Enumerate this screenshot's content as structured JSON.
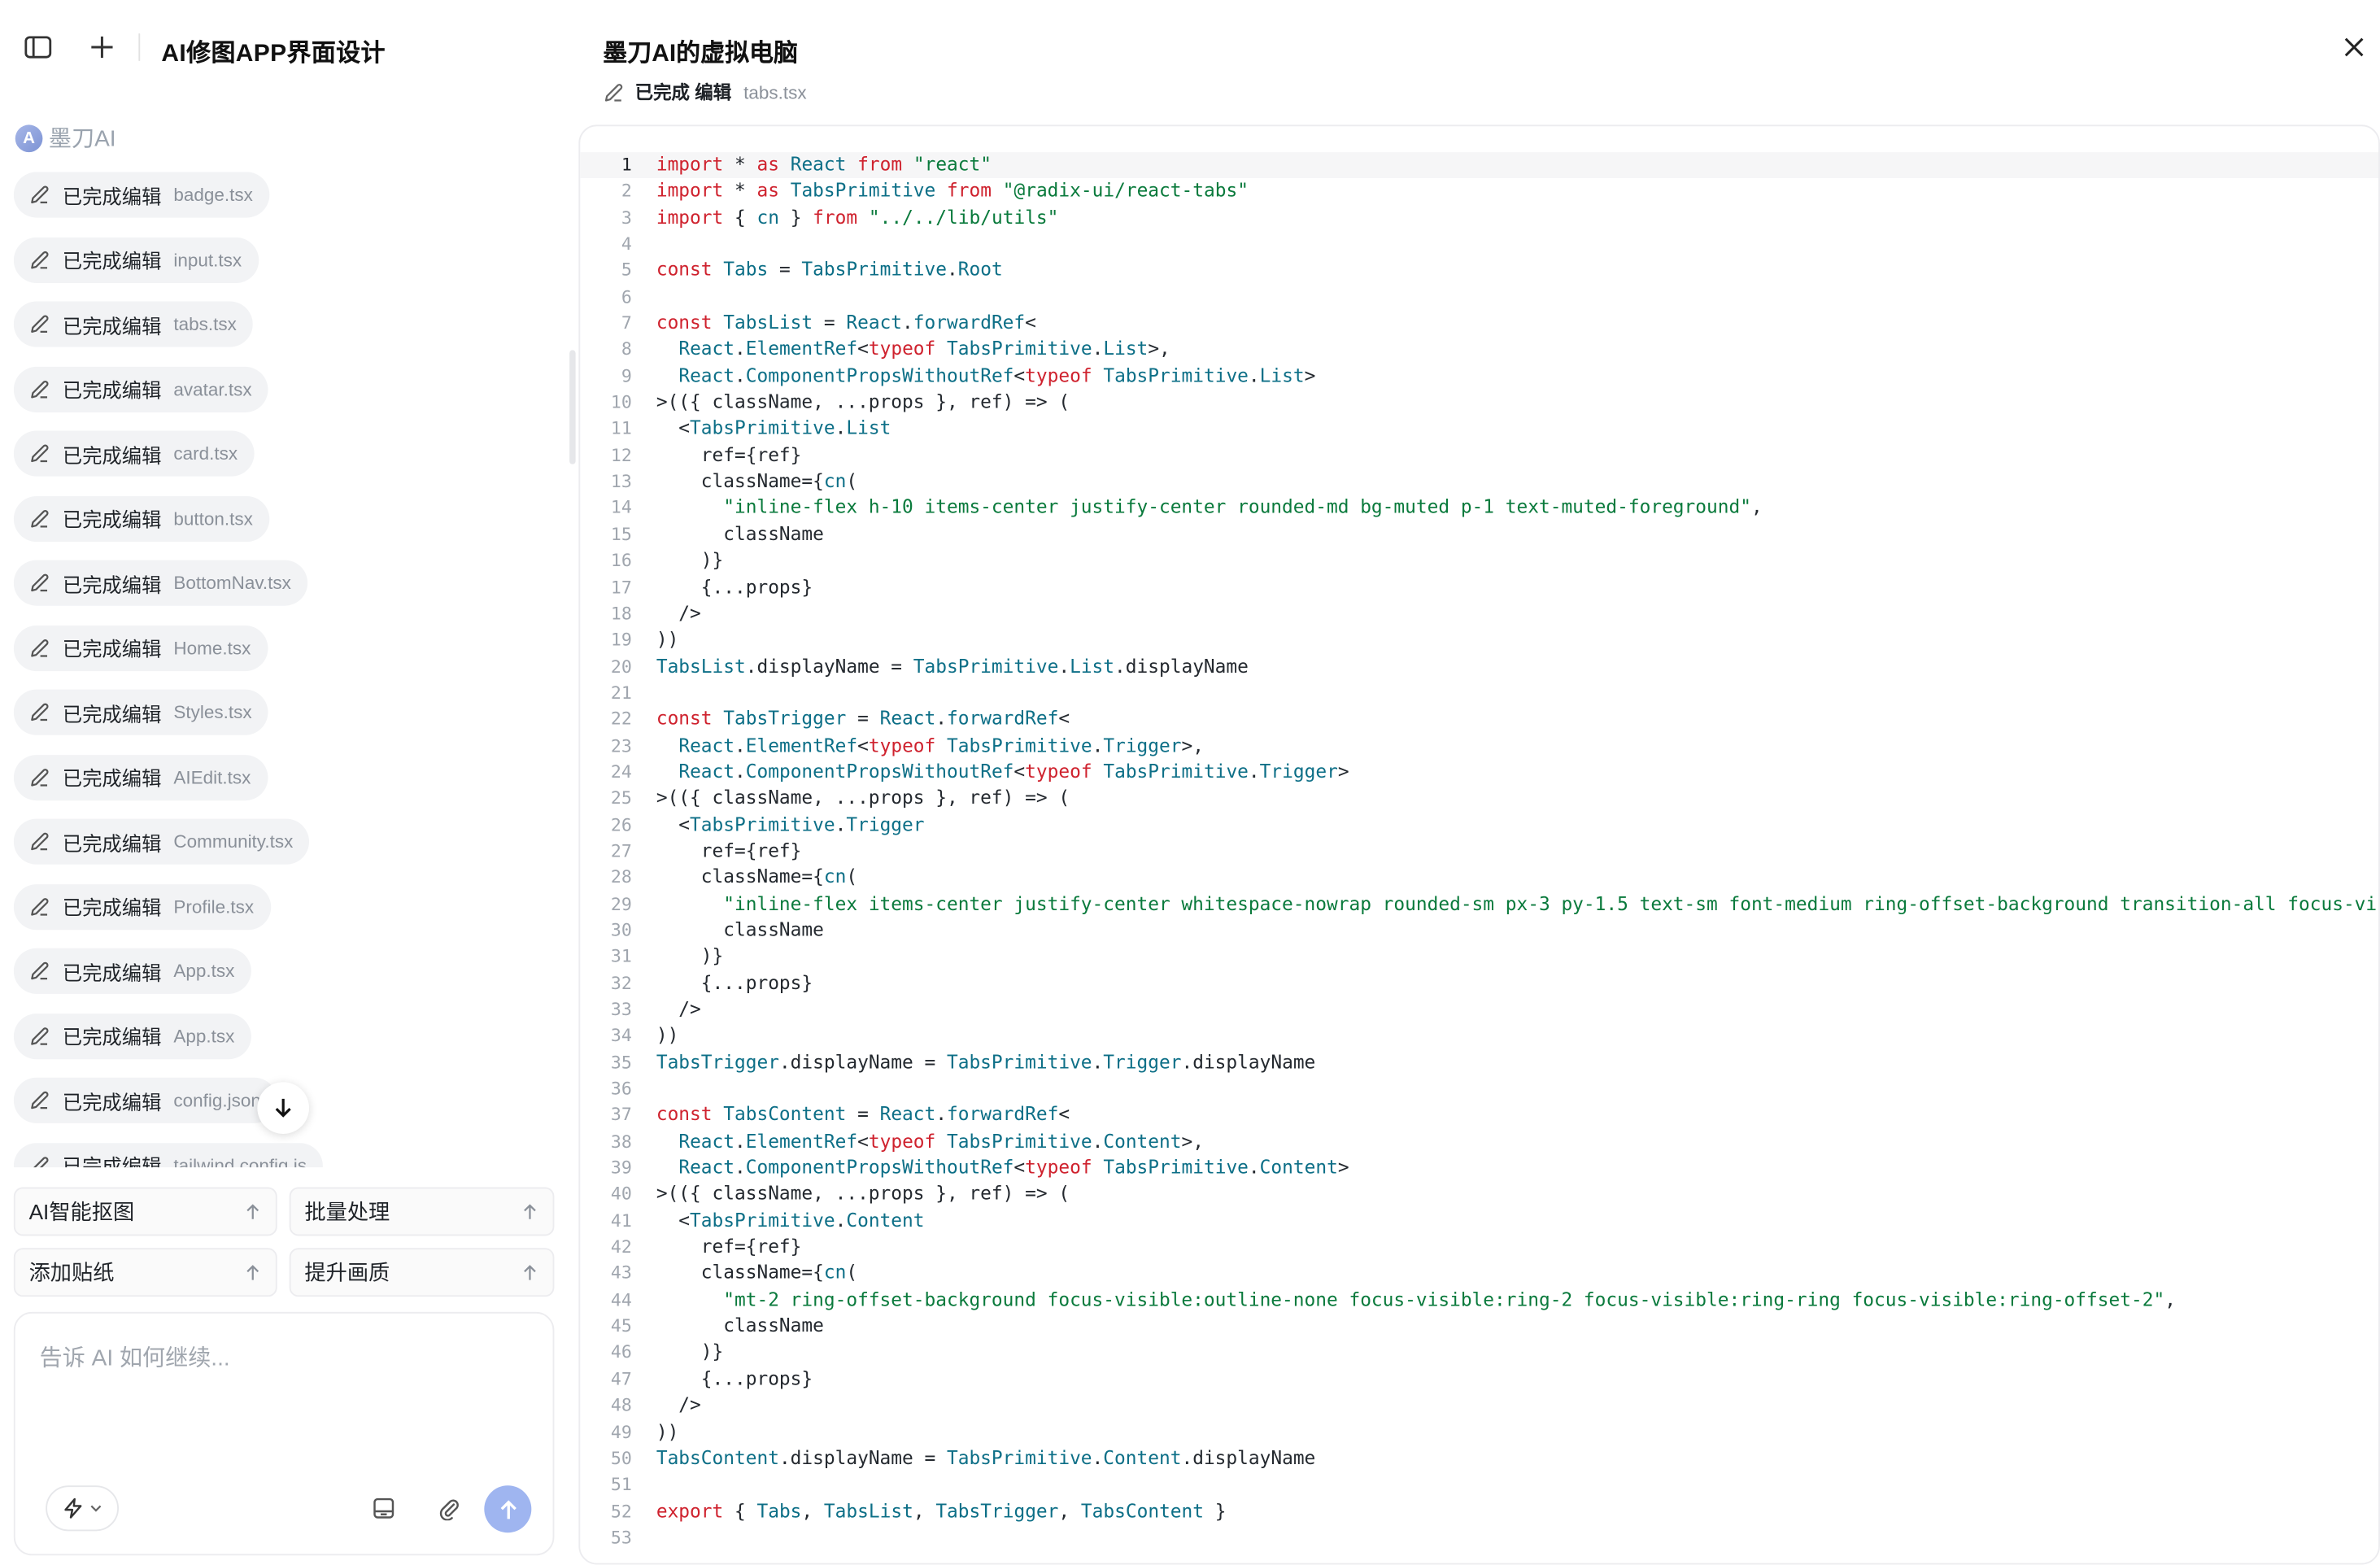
{
  "sidebar": {
    "app_title": "AI修图APP界面设计",
    "brand": "墨刀AI",
    "brand_logo_letter": "A",
    "items": [
      {
        "status": "已完成编辑",
        "file": "badge.tsx"
      },
      {
        "status": "已完成编辑",
        "file": "input.tsx"
      },
      {
        "status": "已完成编辑",
        "file": "tabs.tsx"
      },
      {
        "status": "已完成编辑",
        "file": "avatar.tsx"
      },
      {
        "status": "已完成编辑",
        "file": "card.tsx"
      },
      {
        "status": "已完成编辑",
        "file": "button.tsx"
      },
      {
        "status": "已完成编辑",
        "file": "BottomNav.tsx"
      },
      {
        "status": "已完成编辑",
        "file": "Home.tsx"
      },
      {
        "status": "已完成编辑",
        "file": "Styles.tsx"
      },
      {
        "status": "已完成编辑",
        "file": "AIEdit.tsx"
      },
      {
        "status": "已完成编辑",
        "file": "Community.tsx"
      },
      {
        "status": "已完成编辑",
        "file": "Profile.tsx"
      },
      {
        "status": "已完成编辑",
        "file": "App.tsx"
      },
      {
        "status": "已完成编辑",
        "file": "App.tsx"
      },
      {
        "status": "已完成编辑",
        "file": "config.json"
      },
      {
        "status": "已完成编辑",
        "file": "tailwind.config.js"
      }
    ],
    "quick_actions": [
      "AI智能抠图",
      "批量处理",
      "添加贴纸",
      "提升画质"
    ],
    "composer_placeholder": "告诉 AI 如何继续..."
  },
  "editor": {
    "title": "墨刀AI的虚拟电脑",
    "status": "已完成 编辑",
    "file": "tabs.tsx",
    "active_line": 1,
    "lines": [
      "import * as React from \"react\"",
      "import * as TabsPrimitive from \"@radix-ui/react-tabs\"",
      "import { cn } from \"../../lib/utils\"",
      "",
      "const Tabs = TabsPrimitive.Root",
      "",
      "const TabsList = React.forwardRef<",
      "  React.ElementRef<typeof TabsPrimitive.List>,",
      "  React.ComponentPropsWithoutRef<typeof TabsPrimitive.List>",
      ">(({ className, ...props }, ref) => (",
      "  <TabsPrimitive.List",
      "    ref={ref}",
      "    className={cn(",
      "      \"inline-flex h-10 items-center justify-center rounded-md bg-muted p-1 text-muted-foreground\",",
      "      className",
      "    )}",
      "    {...props}",
      "  />",
      "))",
      "TabsList.displayName = TabsPrimitive.List.displayName",
      "",
      "const TabsTrigger = React.forwardRef<",
      "  React.ElementRef<typeof TabsPrimitive.Trigger>,",
      "  React.ComponentPropsWithoutRef<typeof TabsPrimitive.Trigger>",
      ">(({ className, ...props }, ref) => (",
      "  <TabsPrimitive.Trigger",
      "    ref={ref}",
      "    className={cn(",
      "      \"inline-flex items-center justify-center whitespace-nowrap rounded-sm px-3 py-1.5 text-sm font-medium ring-offset-background transition-all focus-visible",
      "      className",
      "    )}",
      "    {...props}",
      "  />",
      "))",
      "TabsTrigger.displayName = TabsPrimitive.Trigger.displayName",
      "",
      "const TabsContent = React.forwardRef<",
      "  React.ElementRef<typeof TabsPrimitive.Content>,",
      "  React.ComponentPropsWithoutRef<typeof TabsPrimitive.Content>",
      ">(({ className, ...props }, ref) => (",
      "  <TabsPrimitive.Content",
      "    ref={ref}",
      "    className={cn(",
      "      \"mt-2 ring-offset-background focus-visible:outline-none focus-visible:ring-2 focus-visible:ring-ring focus-visible:ring-offset-2\",",
      "      className",
      "    )}",
      "    {...props}",
      "  />",
      "))",
      "TabsContent.displayName = TabsPrimitive.Content.displayName",
      "",
      "export { Tabs, TabsList, TabsTrigger, TabsContent }",
      ""
    ]
  },
  "icons": {
    "sidebar_toggle": "sidebar-toggle-icon",
    "new_chat": "plus-icon",
    "edit": "pencil-icon",
    "scroll_down": "arrow-down-icon",
    "quick_action": "arrow-up-icon",
    "mode": "lightning-icon",
    "attach_image": "image-icon",
    "attach_file": "paperclip-icon",
    "send": "arrow-up-icon",
    "close": "close-icon"
  },
  "colors": {
    "send_button": "#9fb5f0",
    "chip_bg": "#f2f3f5",
    "string": "#0a7a3c",
    "keyword": "#cf222e",
    "type": "#0d6f87"
  }
}
